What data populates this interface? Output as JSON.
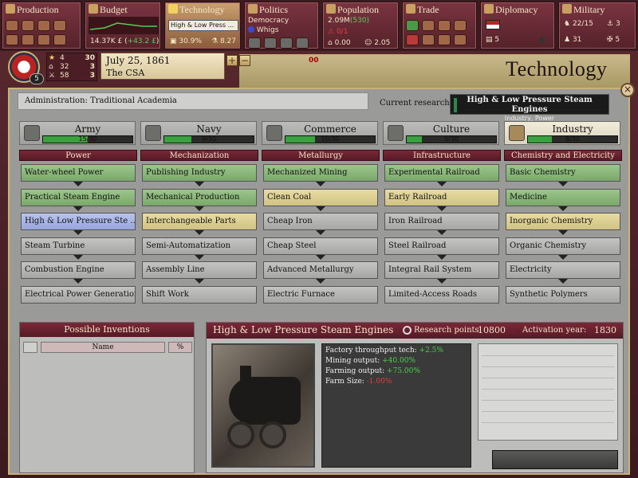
{
  "topbar": {
    "production": {
      "title": "Production"
    },
    "budget": {
      "title": "Budget",
      "funds": "14.37K £",
      "change": "+43.2 £"
    },
    "technology": {
      "title": "Technology",
      "research": "High & Low Press ...",
      "literacy": "30.9%",
      "points": "8.27"
    },
    "politics": {
      "title": "Politics",
      "government": "Democracy",
      "party": "Whigs"
    },
    "population": {
      "title": "Population",
      "total": "2.09M",
      "growth": "(530)",
      "militancy": "0/1",
      "consciousness": "0.00",
      "loyalty": "2.05"
    },
    "trade": {
      "title": "Trade"
    },
    "diplomacy": {
      "title": "Diplomacy",
      "count": "5"
    },
    "military": {
      "title": "Military",
      "manpower": "22/15",
      "units": "3",
      "extra1": "31",
      "extra2": "5"
    }
  },
  "nation": {
    "date": "July 25, 1861",
    "name": "The CSA",
    "speed": "00",
    "rank_badge": "5",
    "ranks": [
      {
        "value": "4",
        "pos": "30"
      },
      {
        "value": "32",
        "pos": "3"
      },
      {
        "value": "58",
        "pos": "3"
      }
    ]
  },
  "window": {
    "title": "Technology",
    "admin_label": "Administration:",
    "admin_value": "Traditional Academia",
    "current_research_label": "Current research:",
    "current_research_name": "High & Low Pressure Steam Engines",
    "current_research_sub": "Industry, Power",
    "close_glyph": "×"
  },
  "tabs": [
    {
      "name": "Army",
      "progress": "15/30",
      "fraction": 0.5,
      "active": false
    },
    {
      "name": "Navy",
      "progress": "9/30",
      "fraction": 0.3,
      "active": false
    },
    {
      "name": "Commerce",
      "progress": "10/30",
      "fraction": 0.333,
      "active": false
    },
    {
      "name": "Culture",
      "progress": "5/30",
      "fraction": 0.167,
      "active": false
    },
    {
      "name": "Industry",
      "progress": "8/30",
      "fraction": 0.267,
      "active": true
    }
  ],
  "columns": [
    {
      "title": "Power",
      "techs": [
        {
          "name": "Water-wheel Power",
          "state": "researched"
        },
        {
          "name": "Practical Steam Engine",
          "state": "researched"
        },
        {
          "name": "High & Low Pressure Ste ...",
          "state": "selected"
        },
        {
          "name": "Steam Turbine",
          "state": "locked"
        },
        {
          "name": "Combustion Engine",
          "state": "locked"
        },
        {
          "name": "Electrical Power Generation",
          "state": "locked"
        }
      ]
    },
    {
      "title": "Mechanization",
      "techs": [
        {
          "name": "Publishing Industry",
          "state": "researched"
        },
        {
          "name": "Mechanical Production",
          "state": "researched"
        },
        {
          "name": "Interchangeable Parts",
          "state": "available"
        },
        {
          "name": "Semi-Automatization",
          "state": "locked"
        },
        {
          "name": "Assembly Line",
          "state": "locked"
        },
        {
          "name": "Shift Work",
          "state": "locked"
        }
      ]
    },
    {
      "title": "Metallurgy",
      "techs": [
        {
          "name": "Mechanized Mining",
          "state": "researched"
        },
        {
          "name": "Clean Coal",
          "state": "available"
        },
        {
          "name": "Cheap Iron",
          "state": "locked"
        },
        {
          "name": "Cheap Steel",
          "state": "locked"
        },
        {
          "name": "Advanced Metallurgy",
          "state": "locked"
        },
        {
          "name": "Electric Furnace",
          "state": "locked"
        }
      ]
    },
    {
      "title": "Infrastructure",
      "techs": [
        {
          "name": "Experimental Railroad",
          "state": "researched"
        },
        {
          "name": "Early Railroad",
          "state": "available"
        },
        {
          "name": "Iron Railroad",
          "state": "locked"
        },
        {
          "name": "Steel Railroad",
          "state": "locked"
        },
        {
          "name": "Integral Rail System",
          "state": "locked"
        },
        {
          "name": "Limited-Access Roads",
          "state": "locked"
        }
      ]
    },
    {
      "title": "Chemistry and Electricity",
      "techs": [
        {
          "name": "Basic Chemistry",
          "state": "researched"
        },
        {
          "name": "Medicine",
          "state": "researched"
        },
        {
          "name": "Inorganic Chemistry",
          "state": "available"
        },
        {
          "name": "Organic Chemistry",
          "state": "locked"
        },
        {
          "name": "Electricity",
          "state": "locked"
        },
        {
          "name": "Synthetic Polymers",
          "state": "locked"
        }
      ]
    }
  ],
  "inventions": {
    "title": "Possible Inventions",
    "col_name": "Name",
    "col_pct": "%"
  },
  "detail": {
    "title": "High & Low Pressure Steam Engines",
    "research_points_label": "Research points:",
    "research_points": "10800",
    "activation_label": "Activation year:",
    "activation_year": "1830",
    "effects": [
      {
        "label": "Factory throughput tech:",
        "value": "+2.5%",
        "neg": false
      },
      {
        "label": "Mining output:",
        "value": "+40.00%",
        "neg": false
      },
      {
        "label": "Farming output:",
        "value": "+75.00%",
        "neg": false
      },
      {
        "label": "Farm Size:",
        "value": "-1.00%",
        "neg": true
      }
    ]
  },
  "colors": {
    "accent": "#7a2838",
    "researched": "#8cb87a",
    "available": "#ddd092",
    "selected": "#a8b6e4",
    "locked": "#b6b6b4"
  }
}
